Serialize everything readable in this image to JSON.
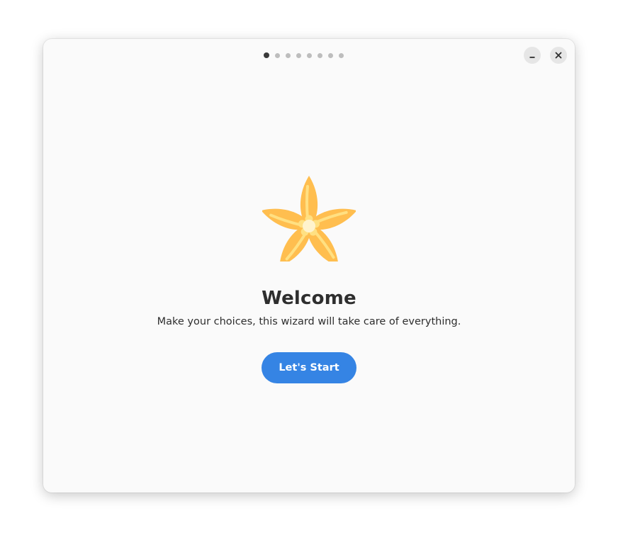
{
  "window": {
    "page_count": 8,
    "current_page": 1,
    "minimize_label": "Minimize",
    "close_label": "Close"
  },
  "welcome": {
    "logo_icon": "flower-icon",
    "title": "Welcome",
    "subtitle": "Make your choices, this wizard will take care of everything.",
    "start_label": "Let's Start"
  },
  "colors": {
    "accent": "#3584e4",
    "flower_petal": "#ffbe4f",
    "flower_vein": "#ffe082",
    "flower_center": "#fff3cd"
  }
}
